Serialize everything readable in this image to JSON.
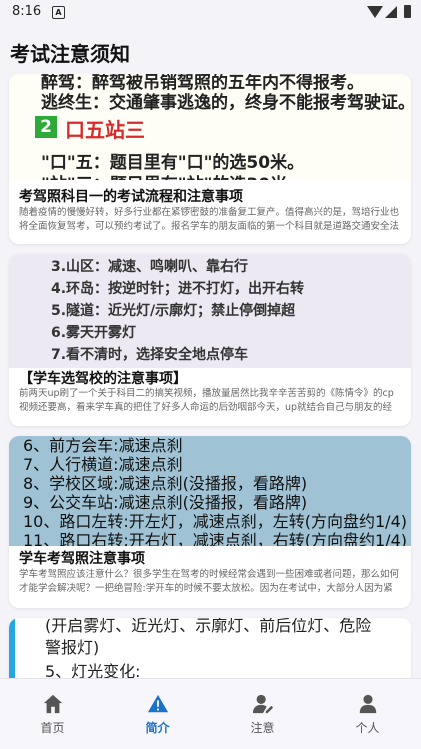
{
  "status_bar": {
    "time": "8:16",
    "notification_icon": "A"
  },
  "header": {
    "title": "考试注意须知"
  },
  "cards": [
    {
      "thumb_lines": [
        "醉驾：醉驾被吊销驾照的五年内不得报考。",
        "逃终生：交通肇事逃逸的，终身不能报考驾驶证。"
      ],
      "thumb_section_number": "2",
      "thumb_section_title": "口五站三",
      "thumb_line_3": "\"口\"五：题目里有\"口\"的选50米。",
      "thumb_line_4": "\"站\"三：题目里有\"站\"的选30米。",
      "title": "考驾照科目一的考试流程和注意事项",
      "desc": "随着疫情的慢慢好转，好多行业都在紧锣密鼓的准备复工复产。值得高兴的是，驾培行业也将全面恢复驾考，可以预约考试了。报名学车的朋友面临的第一个科目就是道路交通安全法5律、法规和相关知识考试。是纯理论考试，涉及到以后开车上路需要注意的事项，驾驶技巧..."
    },
    {
      "thumb_lines": [
        "3.山区：减速、鸣喇叭、靠右行",
        "4.环岛：按逆时针；进不打灯，出开右转",
        "5.隧道：近光灯/示廓灯；禁止停倒掉超",
        "6.雾天开雾灯",
        "7.看不清时，选择安全地点停车"
      ],
      "title": "【学车选驾校的注意事项】",
      "desc": "前两天up刷了一个关于科目二的搞笑视频，播放量居然比我辛辛苦苦剪的《陈情令》的cp视频还要高，看来学车真的把住了好多人命运的后劲咽部今天，up就结合自己与朋友的经验，说一说学车，你需要注意哪些事（要是这篇再蹦掉我就，我就，好吧我也不能怎么样(\"一\"..."
    },
    {
      "thumb_lines": [
        "6、前方会车:减速点刹",
        "7、人行横道:减速点刹",
        "8、学校区域:减速点刹(没播报，看路牌)",
        "9、公交车站:减速点刹(没播报，看路牌)",
        "10、路口左转:开左灯，减速点刹，左转(方向盘约1/4)",
        "11、路口右转:开右灯，减速点刹，右转(方向盘约1/4)"
      ],
      "title": "学车考驾照注意事项",
      "desc": "学车考驾照应该注意什么？很多学生在驾考的时候经常会遇到一些困难或者问题，那么如何才能学会解决呢？一把绝冒险:学开车的时候不要太放松。因为在考试中，大部分人因为紧张而发挥不出正常水平，所以平时练习的时候要对自己要求更严格。二.避免重复同样的错误:一..."
    },
    {
      "thumb_lines": [
        "(开启雾灯、近光灯、示廓灯、前后位灯、危险",
        "警报灯)",
        "5、灯光变化:"
      ]
    }
  ],
  "tabs": [
    {
      "label": "首页",
      "icon": "home-icon",
      "active": false
    },
    {
      "label": "简介",
      "icon": "warning-icon",
      "active": true
    },
    {
      "label": "注意",
      "icon": "user-edit-icon",
      "active": false
    },
    {
      "label": "个人",
      "icon": "person-icon",
      "active": false
    }
  ],
  "colors": {
    "accent": "#1a73c9",
    "tab_icon": "#555555"
  }
}
